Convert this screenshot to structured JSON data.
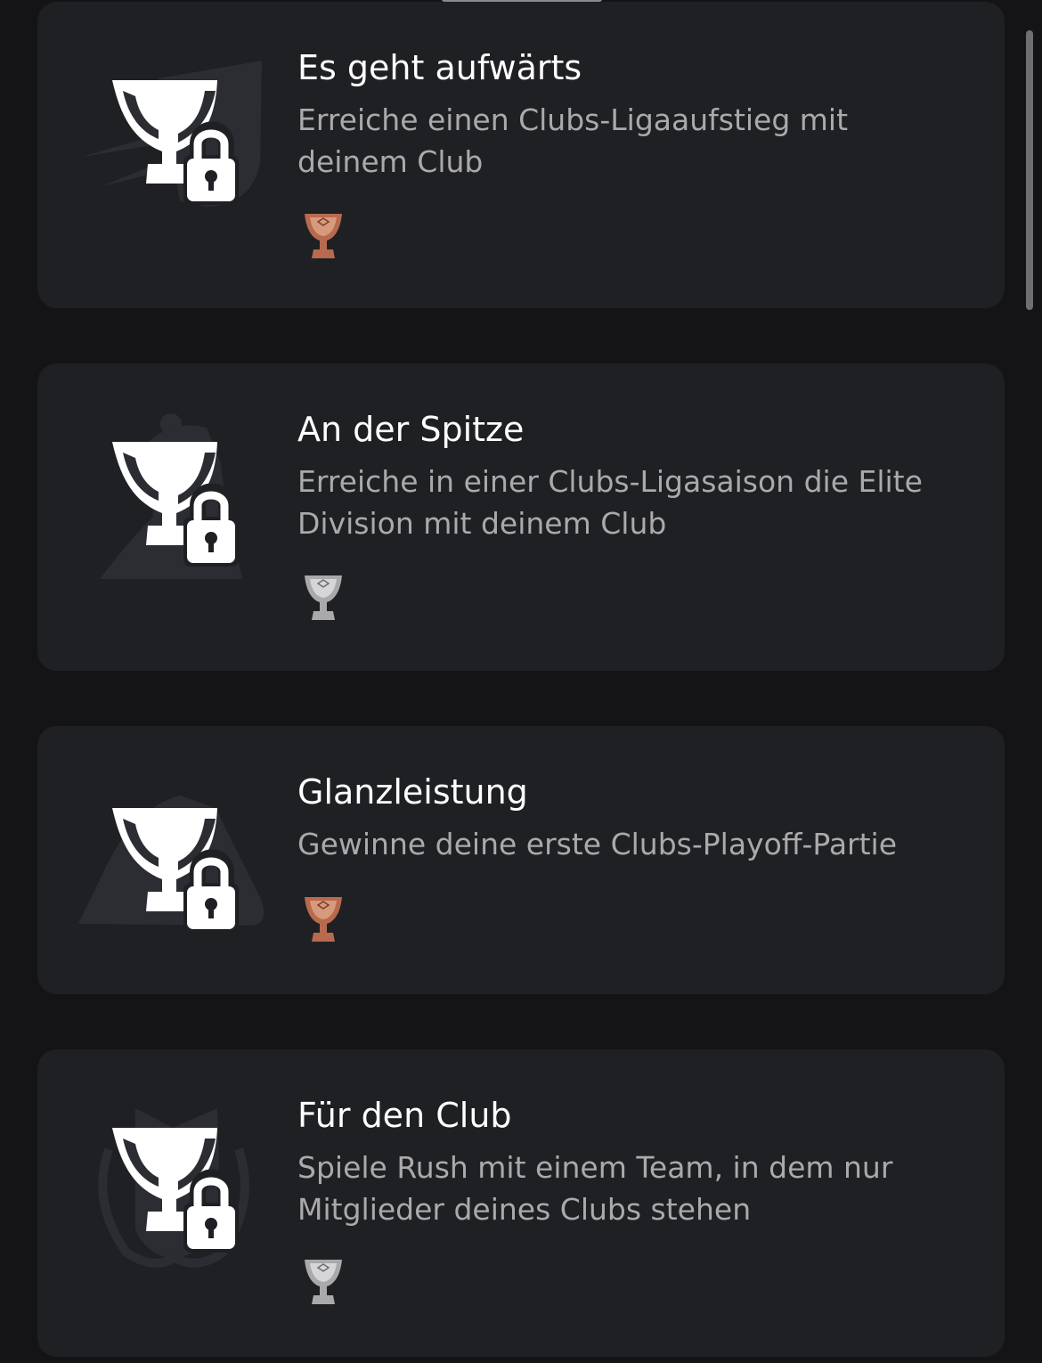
{
  "trophies": [
    {
      "title": "Es geht aufwärts",
      "description": "Erreiche einen Clubs-Ligaaufstieg mit deinem Club",
      "grade": "bronze",
      "locked": true,
      "art_icon": "shield-speed-icon"
    },
    {
      "title": "An der Spitze",
      "description": "Erreiche in einer Clubs-Ligasaison die Elite Division mit deinem Club",
      "grade": "silver",
      "locked": true,
      "art_icon": "player-silhouette-icon"
    },
    {
      "title": "Glanzleistung",
      "description": "Gewinne deine erste Clubs-Playoff-Partie",
      "grade": "bronze",
      "locked": true,
      "art_icon": "boot-icon"
    },
    {
      "title": "Für den Club",
      "description": "Spiele Rush mit einem Team, in dem nur Mitglieder deines Clubs stehen",
      "grade": "silver",
      "locked": true,
      "art_icon": "laurel-crest-icon"
    }
  ],
  "colors": {
    "background": "#141416",
    "card": "#1f2023",
    "title": "#ffffff",
    "description": "#aaaaac",
    "bronze": "#b86a4e",
    "silver": "#a9a9ab",
    "art_shape": "#2b2d33"
  }
}
